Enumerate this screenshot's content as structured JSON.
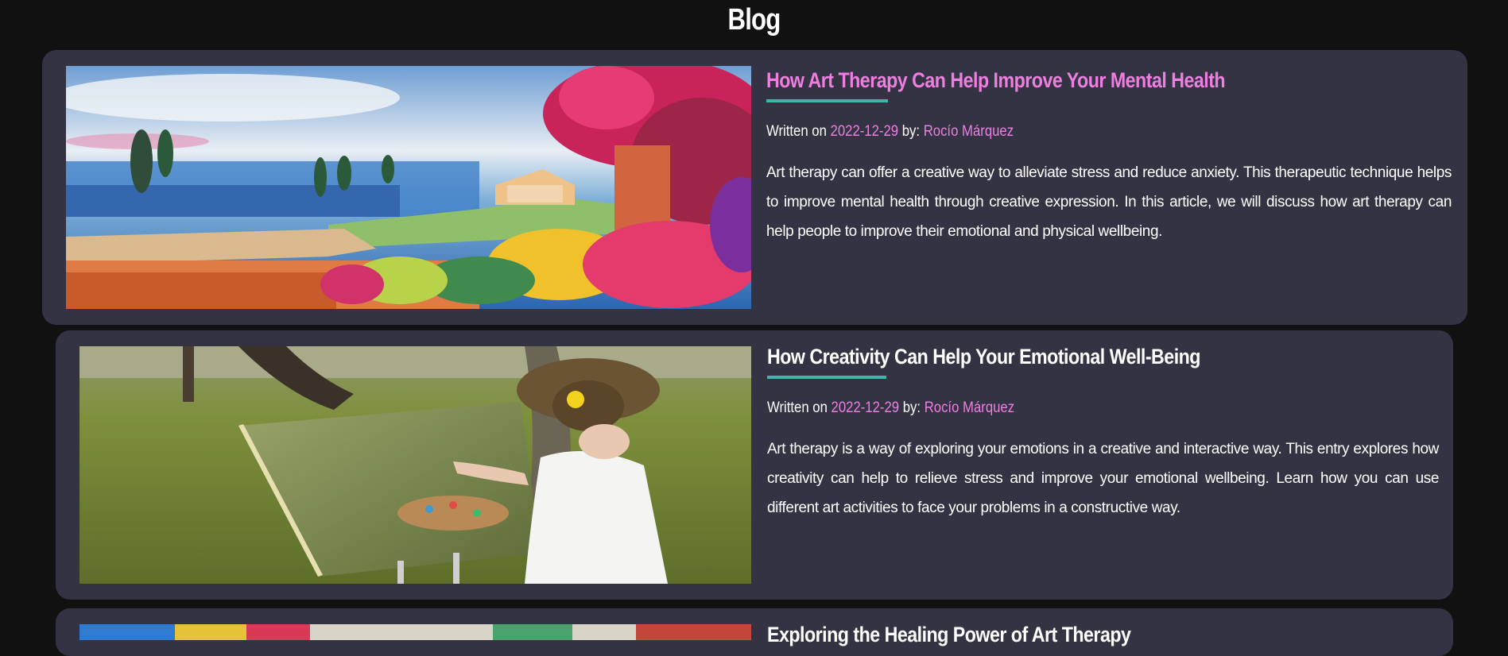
{
  "header": {
    "title": "Blog"
  },
  "posts": [
    {
      "title": "How Art Therapy Can Help Improve Your Mental Health",
      "written_on_label": "Written on",
      "date": "2022-12-29",
      "by_label": "by:",
      "author": "Rocío Márquez",
      "excerpt": "Art therapy can offer a creative way to alleviate stress and reduce anxiety. This therapeutic technique helps to improve mental health through creative expression. In this article, we will discuss how art therapy can help people to improve their emotional and physical wellbeing.",
      "image": "watercolor-coastal-landscape"
    },
    {
      "title": "How Creativity Can Help Your Emotional Well-Being",
      "written_on_label": "Written on",
      "date": "2022-12-29",
      "by_label": "by:",
      "author": "Rocío Márquez",
      "excerpt": "Art therapy is a way of exploring your emotions in a creative and interactive way. This entry explores how creativity can help to relieve stress and improve your emotional wellbeing. Learn how you can use different art activities to face your problems in a constructive way.",
      "image": "woman-painting-outdoors"
    },
    {
      "title": "Exploring the Healing Power of Art Therapy",
      "image": "colorful-paint-palette"
    }
  ],
  "colors": {
    "background": "#111112",
    "card": "#333343",
    "accent_pink": "#ee7fe0",
    "accent_teal": "#3fb6a7"
  }
}
